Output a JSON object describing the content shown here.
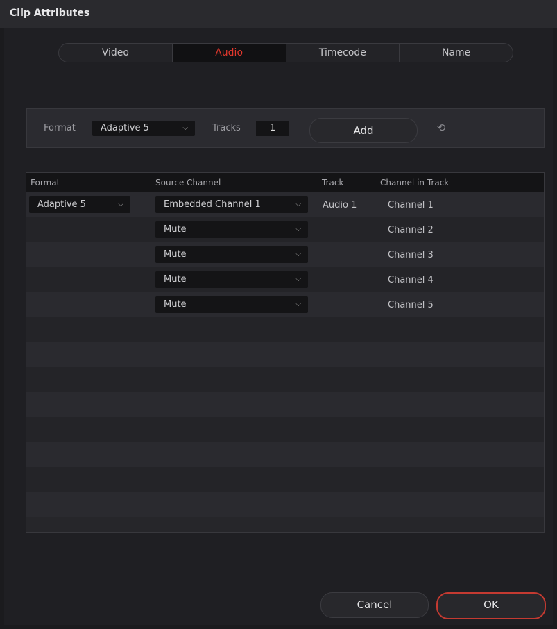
{
  "window": {
    "title": "Clip Attributes"
  },
  "tabs": [
    {
      "label": "Video",
      "active": false
    },
    {
      "label": "Audio",
      "active": true
    },
    {
      "label": "Timecode",
      "active": false
    },
    {
      "label": "Name",
      "active": false
    }
  ],
  "format_bar": {
    "format_label": "Format",
    "format_value": "Adaptive 5",
    "tracks_label": "Tracks",
    "tracks_value": "1",
    "add_label": "Add",
    "reset_icon": "reset-icon"
  },
  "table": {
    "headers": [
      "Format",
      "Source Channel",
      "Track",
      "Channel in Track"
    ],
    "format_value": "Adaptive 5",
    "track_value": "Audio 1",
    "rows": [
      {
        "source": "Embedded Channel 1",
        "channel": "Channel 1"
      },
      {
        "source": "Mute",
        "channel": "Channel 2"
      },
      {
        "source": "Mute",
        "channel": "Channel 3"
      },
      {
        "source": "Mute",
        "channel": "Channel 4"
      },
      {
        "source": "Mute",
        "channel": "Channel 5"
      }
    ]
  },
  "footer": {
    "cancel_label": "Cancel",
    "ok_label": "OK"
  },
  "colors": {
    "accent": "#e2382d",
    "ok_border": "#c43a31",
    "background": "#1f1f23"
  }
}
